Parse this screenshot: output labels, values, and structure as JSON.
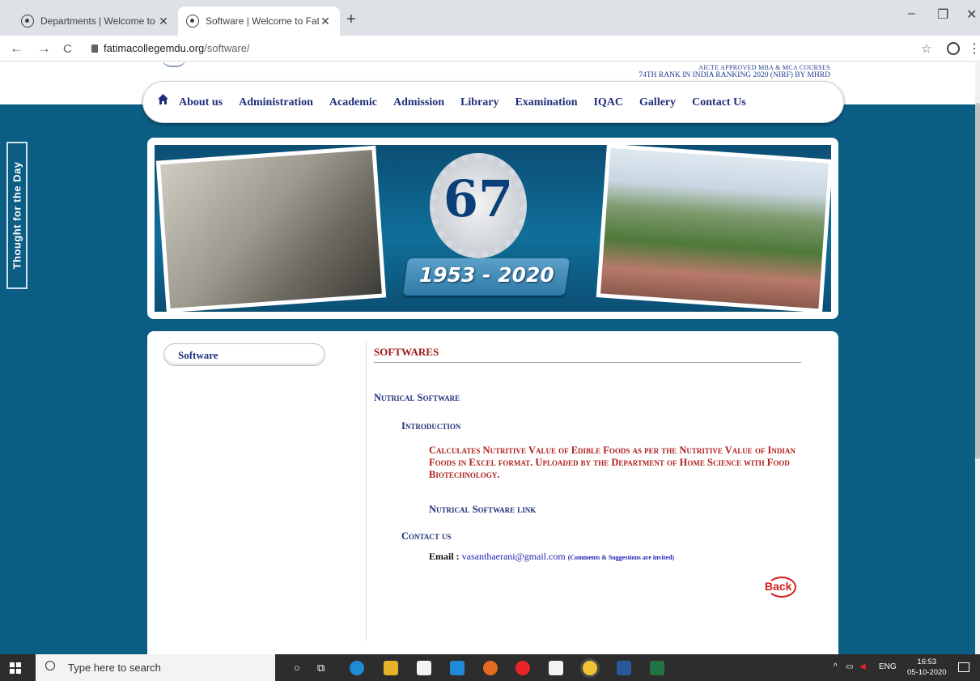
{
  "browser": {
    "tabs": [
      {
        "title": "Departments | Welcome to Fatim",
        "active": false
      },
      {
        "title": "Software | Welcome to Fatima Co",
        "active": true
      }
    ],
    "new_tab": "+",
    "window_controls": {
      "minimize": "–",
      "restore": "❐",
      "close": "✕"
    },
    "nav": {
      "back": "←",
      "forward": "→",
      "reload": "C"
    },
    "url_host": "fatimacollegemdu.org",
    "url_path": "/software/",
    "star": "☆",
    "menu": "⋮"
  },
  "site": {
    "rank_line1": "AICTE APPROVED MBA & MCA COURSES",
    "rank_line2": "74TH RANK IN INDIA RANKING 2020 (NIRF) BY MHRD",
    "menu": [
      "About us",
      "Administration",
      "Academic",
      "Admission",
      "Library",
      "Examination",
      "IQAC",
      "Gallery",
      "Contact Us"
    ],
    "side_tab": "Thought for the Day",
    "banner": {
      "years": "67",
      "range": "1953 - 2020"
    }
  },
  "content": {
    "sidebar_item": "Software",
    "heading": "SOFTWARES",
    "software_title": "Nutrical Software",
    "intro_label": "Introduction",
    "description": "Calculates Nutritive Value of Edible Foods as per the Nutritive Value of Indian Foods in Excel format. Uploaded by the Department of Home Science with Food Biotechnology.",
    "software_link": "Nutrical Software link",
    "contact_label": "Contact us",
    "email_label": "Email :",
    "email": "vasanthaerani@gmail.com",
    "email_note": "(Comments & Suggestions are invited)",
    "back": "Back"
  },
  "taskbar": {
    "search_placeholder": "Type here to search",
    "lang": "ENG",
    "time": "16:53",
    "date": "05-10-2020"
  },
  "colors": {
    "page_bg": "#0c5d84",
    "nav_text": "#1f2e7a",
    "heading_red": "#9a1818",
    "back_red": "#d91d1d"
  }
}
